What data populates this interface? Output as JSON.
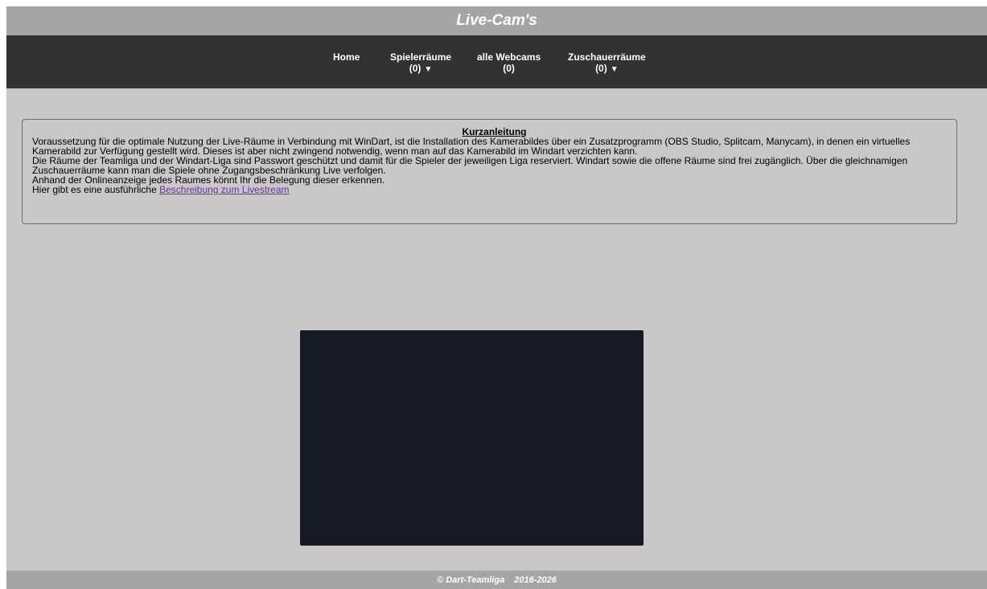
{
  "header": {
    "title": "Live-Cam's"
  },
  "nav": {
    "home": {
      "label": "Home"
    },
    "spielerraeume": {
      "label": "Spielerräume",
      "count": "(0)"
    },
    "webcams": {
      "label": "alle Webcams",
      "count": "(0)"
    },
    "zuschauerraeume": {
      "label": "Zuschauerräume",
      "count": "(0)"
    },
    "dropdown_icon": "triangle-down"
  },
  "info": {
    "heading": "Kurzanleitung",
    "lines": [
      "Voraussetzung für die optimale Nutzung der Live-Räume in Verbindung mit WinDart, ist die Installation des Kamerabildes über ein Zusatzprogramm (OBS Studio, Splitcam, Manycam), in denen ein virtuelles",
      "Kamerabild zur Verfügung gestellt wird. Dieses ist aber nicht zwingend notwendig, wenn man auf das Kamerabild im Windart verzichten kann.",
      "Die Räume der Teamliga und der Windart-Liga sind Passwort geschützt und damit für die Spieler der jeweiligen Liga reserviert. Windart sowie die offene Räume sind frei zugänglich. Über die gleichnamigen",
      "Zuschauerräume kann man die Spiele ohne Zugangsbeschränkung Live verfolgen.",
      "Anhand der Onlineanzeige jedes Raumes könnt Ihr die Belegung dieser erkennen."
    ],
    "last_line_prefix": "Hier gibt es eine ausführliche ",
    "link_text": "Beschreibung zum Livestream"
  },
  "footer": {
    "copyright": "© Dart-Teamliga",
    "years": "2016-2026"
  },
  "colors": {
    "background": "#cac7c8",
    "title_bar": "#a5a5a5",
    "nav_bar": "#323232",
    "video": "#151a23",
    "link": "#6a2fa6"
  }
}
